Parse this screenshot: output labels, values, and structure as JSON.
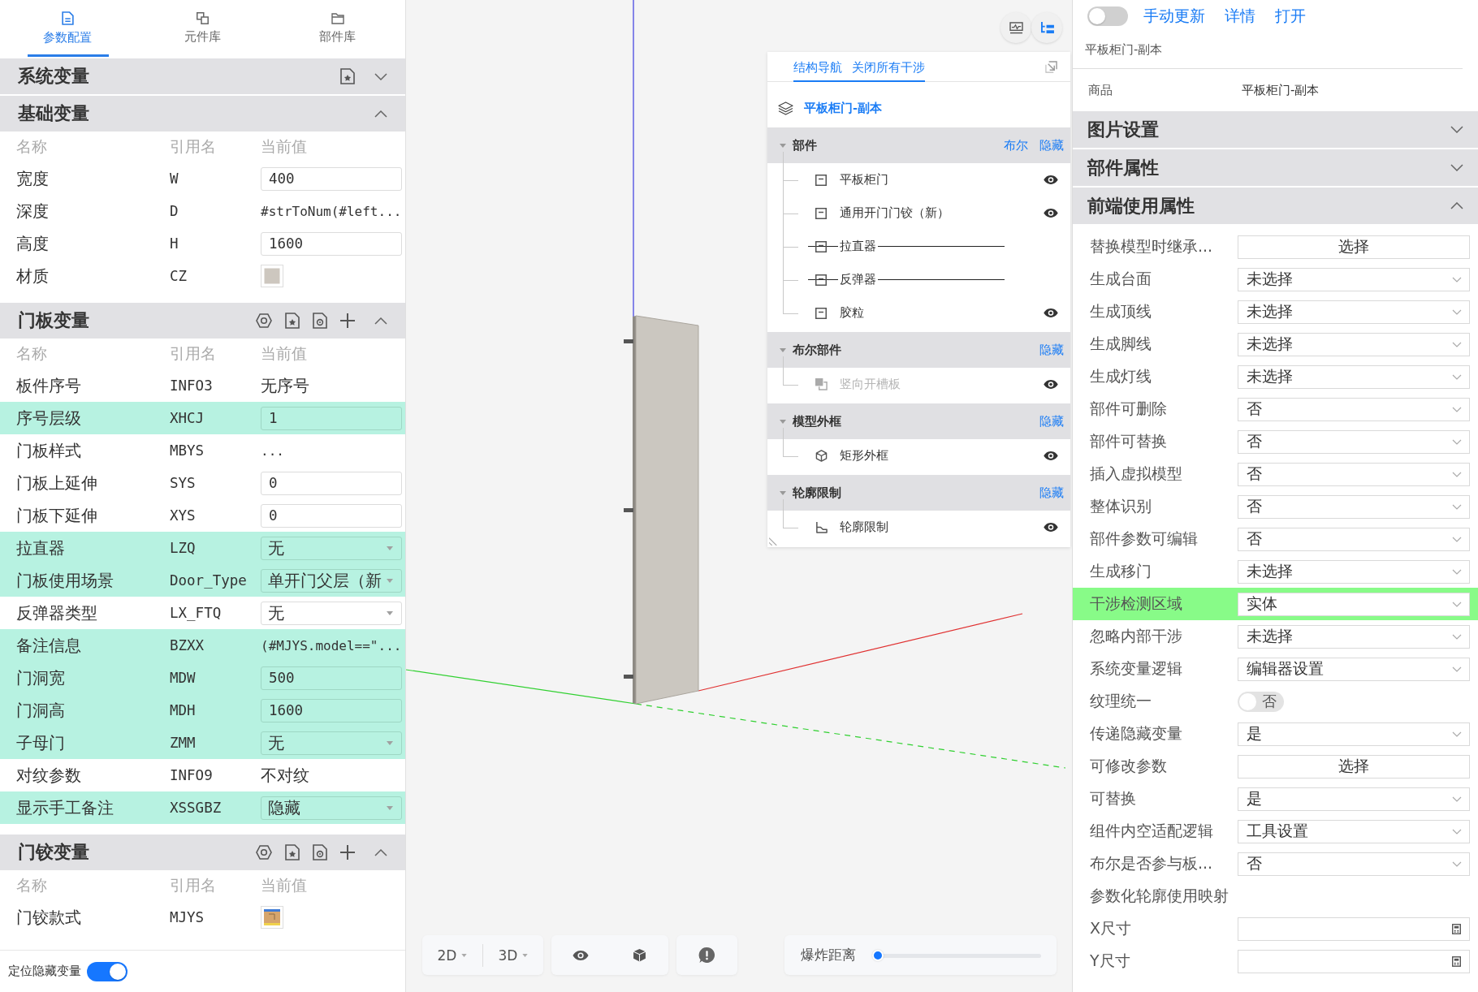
{
  "param_panel": {
    "tabs": [
      {
        "label": "参数配置",
        "selected": true
      },
      {
        "label": "元件库",
        "selected": false
      },
      {
        "label": "部件库",
        "selected": false
      }
    ],
    "sections": [
      {
        "title": "系统变量",
        "kind": "system",
        "expanded": false
      },
      {
        "title": "基础变量",
        "kind": "basic",
        "expanded": true,
        "columns": [
          "名称",
          "引用名",
          "当前值"
        ],
        "rows": [
          {
            "name": "宽度",
            "ref": "W",
            "kind": "input",
            "value": "400",
            "highlighted": false
          },
          {
            "name": "深度",
            "ref": "D",
            "kind": "formula",
            "value": "#strToNum(#left...",
            "highlighted": false
          },
          {
            "name": "高度",
            "ref": "H",
            "kind": "input",
            "value": "1600",
            "highlighted": false
          },
          {
            "name": "材质",
            "ref": "CZ",
            "kind": "swatch",
            "highlighted": false
          }
        ]
      },
      {
        "title": "门板变量",
        "kind": "custom",
        "expanded": true,
        "columns": [
          "名称",
          "引用名",
          "当前值"
        ],
        "rows": [
          {
            "name": "板件序号",
            "ref": "INFO3",
            "kind": "text",
            "value": "无序号",
            "highlighted": false
          },
          {
            "name": "序号层级",
            "ref": "XHCJ",
            "kind": "input",
            "value": "1",
            "highlighted": true
          },
          {
            "name": "门板样式",
            "ref": "MBYS",
            "kind": "formula",
            "value": "...",
            "highlighted": false
          },
          {
            "name": "门板上延伸",
            "ref": "SYS",
            "kind": "input",
            "value": "0",
            "highlighted": false
          },
          {
            "name": "门板下延伸",
            "ref": "XYS",
            "kind": "input",
            "value": "0",
            "highlighted": false
          },
          {
            "name": "拉直器",
            "ref": "LZQ",
            "kind": "select",
            "value": "无",
            "highlighted": true
          },
          {
            "name": "门板使用场景",
            "ref": "Door_Type",
            "kind": "select",
            "value": "单开门父层（新",
            "highlighted": true
          },
          {
            "name": "反弹器类型",
            "ref": "LX_FTQ",
            "kind": "select",
            "value": "无",
            "highlighted": false
          },
          {
            "name": "备注信息",
            "ref": "BZXX",
            "kind": "formula",
            "value": "(#MJYS.model==\"...",
            "highlighted": true
          },
          {
            "name": "门洞宽",
            "ref": "MDW",
            "kind": "input",
            "value": "500",
            "highlighted": true
          },
          {
            "name": "门洞高",
            "ref": "MDH",
            "kind": "input",
            "value": "1600",
            "highlighted": true
          },
          {
            "name": "子母门",
            "ref": "ZMM",
            "kind": "select",
            "value": "无",
            "highlighted": true
          },
          {
            "name": "对纹参数",
            "ref": "INFO9",
            "kind": "text",
            "value": "不对纹",
            "highlighted": false
          },
          {
            "name": "显示手工备注",
            "ref": "XSSGBZ",
            "kind": "select",
            "value": "隐藏",
            "highlighted": true
          }
        ]
      },
      {
        "title": "门铰变量",
        "kind": "custom",
        "expanded": true,
        "columns": [
          "名称",
          "引用名",
          "当前值"
        ],
        "rows": [
          {
            "name": "门铰款式",
            "ref": "MJYS",
            "kind": "image",
            "highlighted": false
          }
        ]
      }
    ],
    "footer": {
      "label": "定位隐藏变量",
      "on": true
    }
  },
  "viewport": {
    "view_toggles": [
      {
        "kind": "monitor",
        "selected": false
      },
      {
        "kind": "tree",
        "selected": true
      }
    ],
    "structure_nav": {
      "tabs": [
        {
          "label": "结构导航",
          "selected": true
        }
      ],
      "close_link": "关闭所有干涉",
      "root": "平板柜门-副本",
      "groups": [
        {
          "title": "部件",
          "actions": [
            "布尔",
            "隐藏"
          ],
          "expanded": true,
          "children": [
            {
              "label": "平板柜门",
              "kind": "panel",
              "hidden": false,
              "disabled": false
            },
            {
              "label": "通用开门门铰（新）",
              "kind": "panel",
              "hidden": false,
              "disabled": false
            },
            {
              "label": "拉直器",
              "kind": "panel",
              "hidden": true,
              "disabled": false
            },
            {
              "label": "反弹器",
              "kind": "panel",
              "hidden": true,
              "disabled": false
            },
            {
              "label": "胶粒",
              "kind": "panel",
              "hidden": false,
              "disabled": false
            }
          ]
        },
        {
          "title": "布尔部件",
          "actions": [
            "隐藏"
          ],
          "expanded": true,
          "children": [
            {
              "label": "竖向开槽板",
              "kind": "boolean",
              "hidden": false,
              "disabled": true
            }
          ]
        },
        {
          "title": "模型外框",
          "actions": [
            "隐藏"
          ],
          "expanded": true,
          "children": [
            {
              "label": "矩形外框",
              "kind": "box",
              "hidden": false,
              "disabled": false
            }
          ]
        },
        {
          "title": "轮廓限制",
          "actions": [
            "隐藏"
          ],
          "expanded": true,
          "children": [
            {
              "label": "轮廓限制",
              "kind": "contour",
              "hidden": false,
              "disabled": false
            }
          ]
        }
      ]
    },
    "toolbar": {
      "view_modes": [
        "2D",
        "3D"
      ],
      "explode": {
        "label": "爆炸距离",
        "level": 0
      }
    }
  },
  "property_panel": {
    "toggle": {
      "on": false
    },
    "links": [
      "手动更新",
      "详情",
      "打开"
    ],
    "title": "平板柜门-副本",
    "product": {
      "label": "商品",
      "value": "平板柜门-副本"
    },
    "sections": [
      {
        "title": "图片设置",
        "expanded": false
      },
      {
        "title": "部件属性",
        "expanded": false
      },
      {
        "title": "前端使用属性",
        "expanded": true,
        "rows": [
          {
            "label": "替换模型时继承...",
            "kind": "button",
            "value": "选择",
            "highlighted": false
          },
          {
            "label": "生成台面",
            "kind": "select",
            "value": "未选择",
            "highlighted": false
          },
          {
            "label": "生成顶线",
            "kind": "select",
            "value": "未选择",
            "highlighted": false
          },
          {
            "label": "生成脚线",
            "kind": "select",
            "value": "未选择",
            "highlighted": false
          },
          {
            "label": "生成灯线",
            "kind": "select",
            "value": "未选择",
            "highlighted": false
          },
          {
            "label": "部件可删除",
            "kind": "select",
            "value": "否",
            "highlighted": false
          },
          {
            "label": "部件可替换",
            "kind": "select",
            "value": "否",
            "highlighted": false
          },
          {
            "label": "插入虚拟模型",
            "kind": "select",
            "value": "否",
            "highlighted": false
          },
          {
            "label": "整体识别",
            "kind": "select",
            "value": "否",
            "highlighted": false
          },
          {
            "label": "部件参数可编辑",
            "kind": "select",
            "value": "否",
            "highlighted": false
          },
          {
            "label": "生成移门",
            "kind": "select",
            "value": "未选择",
            "highlighted": false
          },
          {
            "label": "干涉检测区域",
            "kind": "select",
            "value": "实体",
            "highlighted": true
          },
          {
            "label": "忽略内部干涉",
            "kind": "select",
            "value": "未选择",
            "highlighted": false
          },
          {
            "label": "系统变量逻辑",
            "kind": "select",
            "value": "编辑器设置",
            "highlighted": false
          },
          {
            "label": "纹理统一",
            "kind": "toggle",
            "value": "否",
            "on": false,
            "highlighted": false
          },
          {
            "label": "传递隐藏变量",
            "kind": "select",
            "value": "是",
            "highlighted": false
          },
          {
            "label": "可修改参数",
            "kind": "button",
            "value": "选择",
            "highlighted": false
          },
          {
            "label": "可替换",
            "kind": "select",
            "value": "是",
            "highlighted": false
          },
          {
            "label": "组件内空适配逻辑",
            "kind": "select",
            "value": "工具设置",
            "highlighted": false
          },
          {
            "label": "布尔是否参与板...",
            "kind": "select",
            "value": "否",
            "highlighted": false
          },
          {
            "label": "参数化轮廓使用映射",
            "kind": "heading",
            "highlighted": false
          },
          {
            "label": "X尺寸",
            "kind": "input",
            "highlighted": false
          },
          {
            "label": "Y尺寸",
            "kind": "input",
            "highlighted": false
          }
        ]
      }
    ]
  }
}
